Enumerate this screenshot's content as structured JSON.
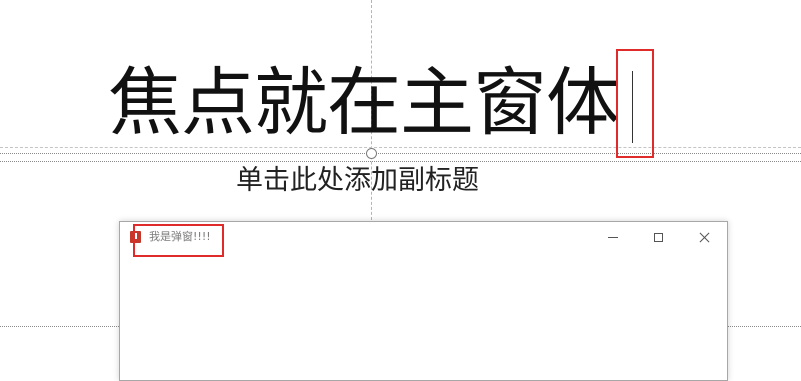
{
  "slide": {
    "title": "焦点就在主窗体",
    "subtitle_placeholder": "单击此处添加副标题"
  },
  "popup": {
    "title": "我是弹窗!!!!",
    "app_icon": "powerpoint-app-icon",
    "controls": {
      "minimize_icon": "minimize-icon",
      "maximize_icon": "maximize-icon",
      "close_icon": "close-icon"
    }
  },
  "annotations": {
    "highlight_color": "#e02b2b"
  }
}
